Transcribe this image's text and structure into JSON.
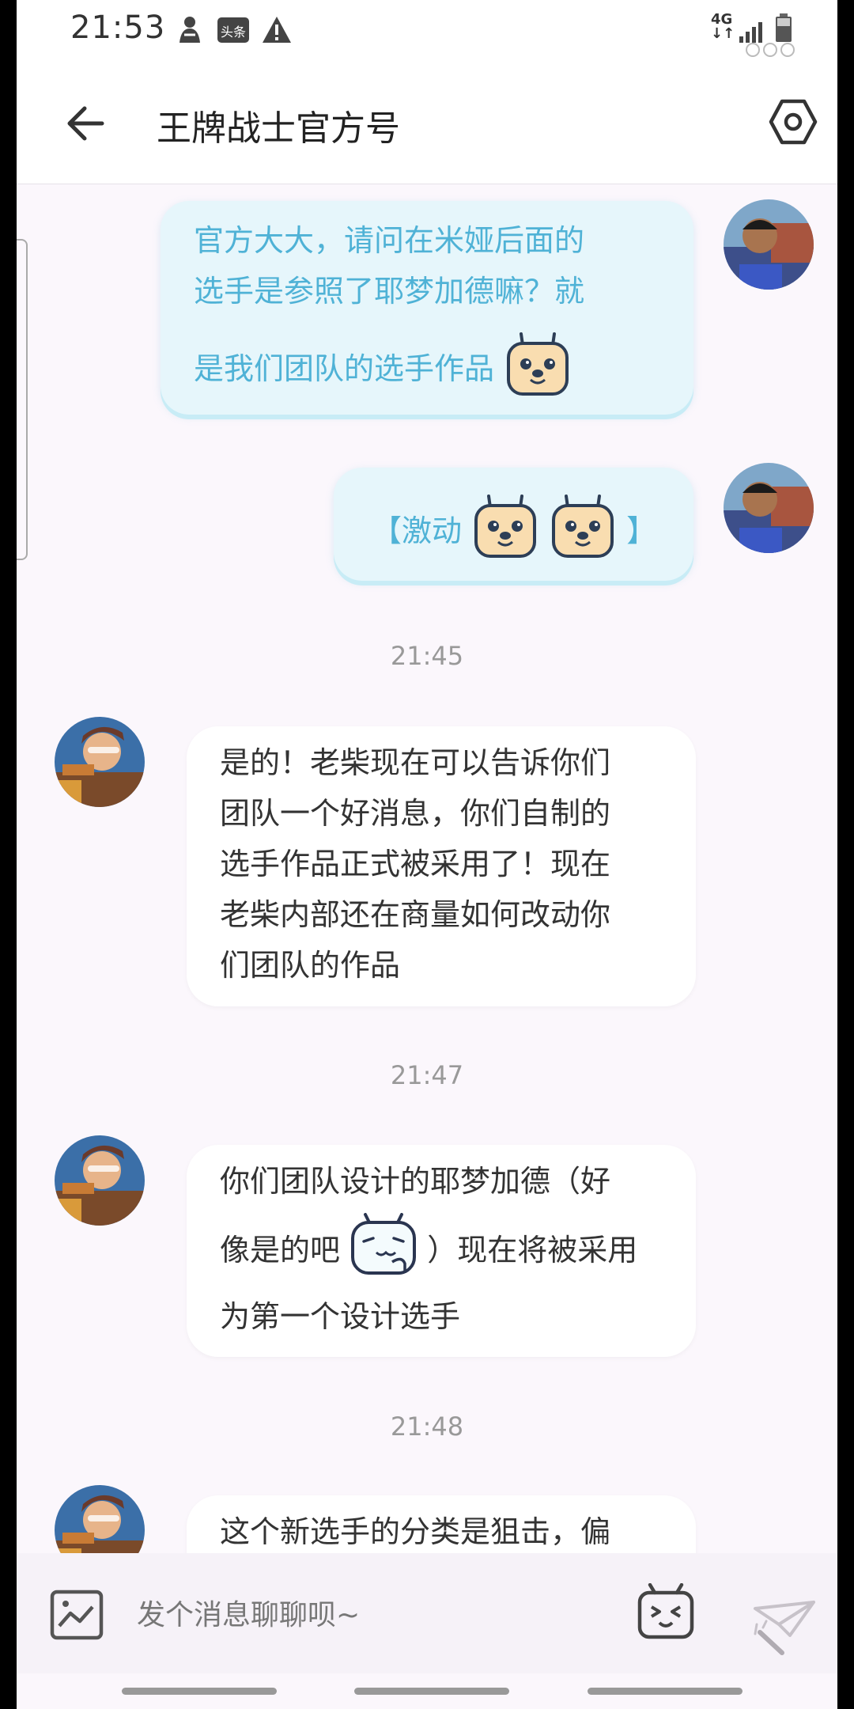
{
  "status_bar": {
    "time": "21:53",
    "network": "4G",
    "icons": [
      "notification-app-icon",
      "toutiao-icon",
      "warning-icon",
      "signal-icon",
      "battery-icon"
    ]
  },
  "header": {
    "title": "王牌战士官方号",
    "back_icon": "arrow-left-icon",
    "settings_icon": "hexagon-settings-icon"
  },
  "messages": [
    {
      "sender": "me",
      "lines": [
        "官方大大，请问在米娅后面的",
        "选手是参照了耶梦加德嘛？就",
        "是我们团队的选手作品"
      ],
      "emoji": "dog-face-emoji"
    },
    {
      "sender": "me",
      "open_bracket": "【激动",
      "close_bracket": "】",
      "emoji": "dog-face-emoji"
    },
    {
      "timestamp": "21:45",
      "sender": "official",
      "lines": [
        "是的！老柴现在可以告诉你们",
        "团队一个好消息，你们自制的",
        "选手作品正式被采用了！现在",
        "老柴内部还在商量如何改动你",
        "们团队的作品"
      ]
    },
    {
      "timestamp": "21:47",
      "sender": "official",
      "line1": "你们团队设计的耶梦加德（好",
      "line2_before": "像是的吧",
      "line2_after": "）现在将被采用",
      "line3": "为第一个设计选手",
      "emoji": "bilibili-shy-emoji"
    },
    {
      "timestamp": "21:48",
      "sender": "official",
      "lines": [
        "这个新选手的分类是狙击，偏"
      ]
    }
  ],
  "input_bar": {
    "placeholder": "发个消息聊聊呗~",
    "image_icon": "image-icon",
    "emoji_icon": "bilibili-tv-emoji-icon",
    "send_icon": "send-plane-icon"
  },
  "colors": {
    "background": "#fbf7fc",
    "outgoing_bubble": "#e6f6fb",
    "outgoing_text": "#4fb2d6",
    "incoming_bubble": "#ffffff",
    "incoming_text": "#333333",
    "timestamp": "#999999"
  }
}
